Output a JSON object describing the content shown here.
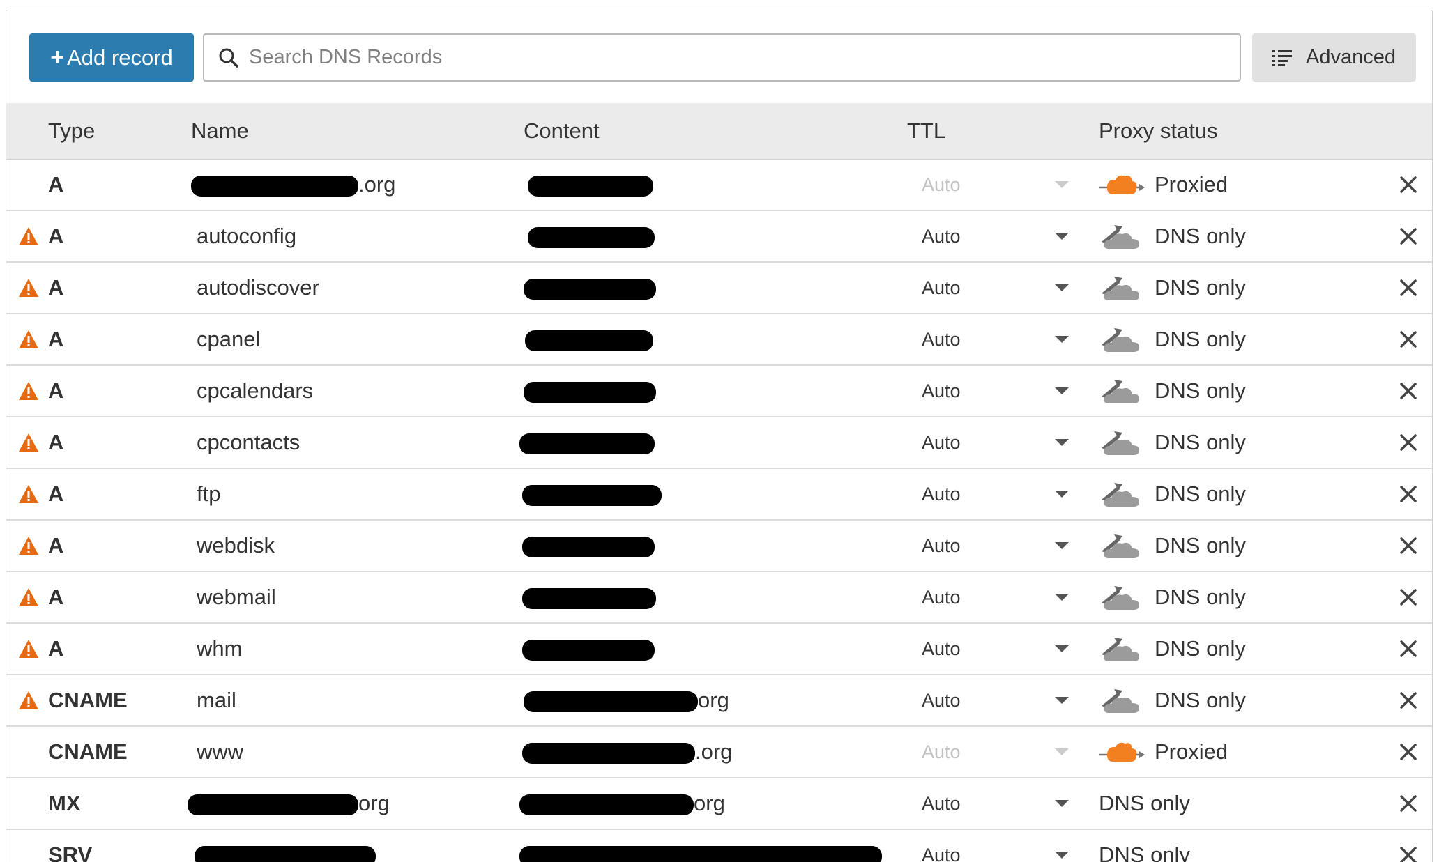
{
  "toolbar": {
    "add_label": "Add record",
    "search_placeholder": "Search DNS Records",
    "advanced_label": "Advanced"
  },
  "columns": {
    "type": "Type",
    "name": "Name",
    "content": "Content",
    "ttl": "TTL",
    "proxy": "Proxy status"
  },
  "colors": {
    "primary": "#2c7cb0",
    "warning": "#e66a12",
    "proxied_cloud": "#f38020",
    "dns_only_cloud": "#9b9b9b"
  },
  "rows": [
    {
      "type": "A",
      "name": ".org",
      "content": "",
      "ttl": "Auto",
      "proxy": "Proxied",
      "warning": false
    },
    {
      "type": "A",
      "name": "autoconfig",
      "content": "",
      "ttl": "Auto",
      "proxy": "DNS only",
      "warning": true
    },
    {
      "type": "A",
      "name": "autodiscover",
      "content": "",
      "ttl": "Auto",
      "proxy": "DNS only",
      "warning": true
    },
    {
      "type": "A",
      "name": "cpanel",
      "content": "",
      "ttl": "Auto",
      "proxy": "DNS only",
      "warning": true
    },
    {
      "type": "A",
      "name": "cpcalendars",
      "content": "",
      "ttl": "Auto",
      "proxy": "DNS only",
      "warning": true
    },
    {
      "type": "A",
      "name": "cpcontacts",
      "content": "",
      "ttl": "Auto",
      "proxy": "DNS only",
      "warning": true
    },
    {
      "type": "A",
      "name": "ftp",
      "content": "",
      "ttl": "Auto",
      "proxy": "DNS only",
      "warning": true
    },
    {
      "type": "A",
      "name": "webdisk",
      "content": "",
      "ttl": "Auto",
      "proxy": "DNS only",
      "warning": true
    },
    {
      "type": "A",
      "name": "webmail",
      "content": "",
      "ttl": "Auto",
      "proxy": "DNS only",
      "warning": true
    },
    {
      "type": "A",
      "name": "whm",
      "content": "",
      "ttl": "Auto",
      "proxy": "DNS only",
      "warning": true
    },
    {
      "type": "CNAME",
      "name": "mail",
      "content": "org",
      "ttl": "Auto",
      "proxy": "DNS only",
      "warning": true
    },
    {
      "type": "CNAME",
      "name": "www",
      "content": ".org",
      "ttl": "Auto",
      "proxy": "Proxied",
      "warning": false
    },
    {
      "type": "MX",
      "name": "org",
      "content": "org",
      "ttl": "Auto",
      "proxy": "DNS only",
      "warning": false
    },
    {
      "type": "SRV",
      "name": "",
      "content": "",
      "ttl": "Auto",
      "proxy": "DNS only",
      "warning": false
    }
  ]
}
